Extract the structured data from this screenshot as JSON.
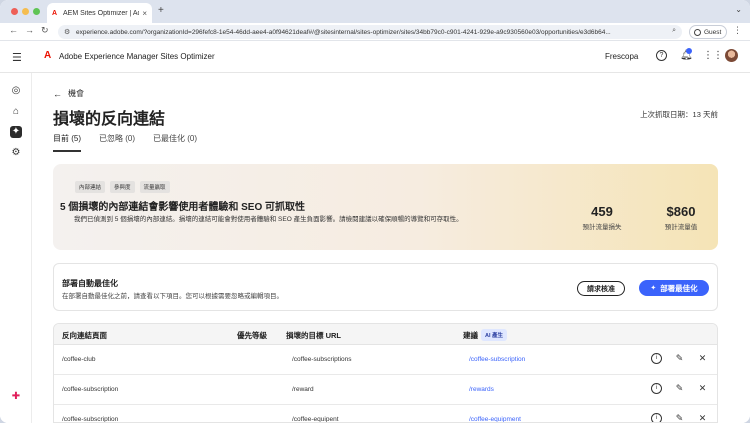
{
  "browser": {
    "tab_title": "AEM Sites Optimizer | Adobe",
    "tab_close": "×",
    "new_tab": "+",
    "url": "experience.adobe.com/?organizationId=296fefc8-1e54-46dd-aee4-a0f94621deaf#/@sitesinternal/sites-optimizer/sites/34bb79c0-c901-4241-929e-a9c930560e03/opportunities/e3d6b64...",
    "profile_label": "Guest"
  },
  "app": {
    "title": "Adobe Experience Manager Sites Optimizer",
    "org": "Frescopa"
  },
  "page": {
    "back_label": "機會",
    "title": "損壞的反向連結",
    "last_fetch": "上次抓取日期：13 天前",
    "tabs": [
      {
        "label": "目前 (5)"
      },
      {
        "label": "已忽略 (0)"
      },
      {
        "label": "已最佳化 (0)"
      }
    ]
  },
  "hero": {
    "pills": [
      "內部連結",
      "參與度",
      "流量贏取"
    ],
    "title": "5 個損壞的內部連結會影響使用者體驗和 SEO 可抓取性",
    "description": "我們已偵測到 5 個損壞的內部連結。損壞的連結可能會對使用者體驗和 SEO 產生負面影響。請檢閱建議以確保順暢的導覽和可存取性。",
    "metrics": [
      {
        "value": "459",
        "label": "預計流量損失"
      },
      {
        "value": "$860",
        "label": "預計流量值"
      }
    ]
  },
  "deploy": {
    "title": "部署自動最佳化",
    "subtitle": "在部署自動最佳化之前，請查看以下項目。您可以根據需要忽略或編輯項目。",
    "approve_label": "請求核准",
    "deploy_label": "部署最佳化"
  },
  "table": {
    "headers": {
      "page": "反向連結頁面",
      "priority": "優先等級",
      "target": "損壞的目標 URL",
      "suggestion": "建議",
      "ai_badge": "AI 產生"
    },
    "rows": [
      {
        "page": "/coffee-club",
        "target": "/coffee-subscriptions",
        "suggestion": "/coffee-subscription"
      },
      {
        "page": "/coffee-subscription",
        "target": "/reward",
        "suggestion": "/rewards"
      },
      {
        "page": "/coffee-subscription",
        "target": "/coffee-equipent",
        "suggestion": "/coffee-equipment"
      }
    ]
  },
  "colors": {
    "accent": "#3b63fb",
    "adobe_red": "#eb1000"
  }
}
